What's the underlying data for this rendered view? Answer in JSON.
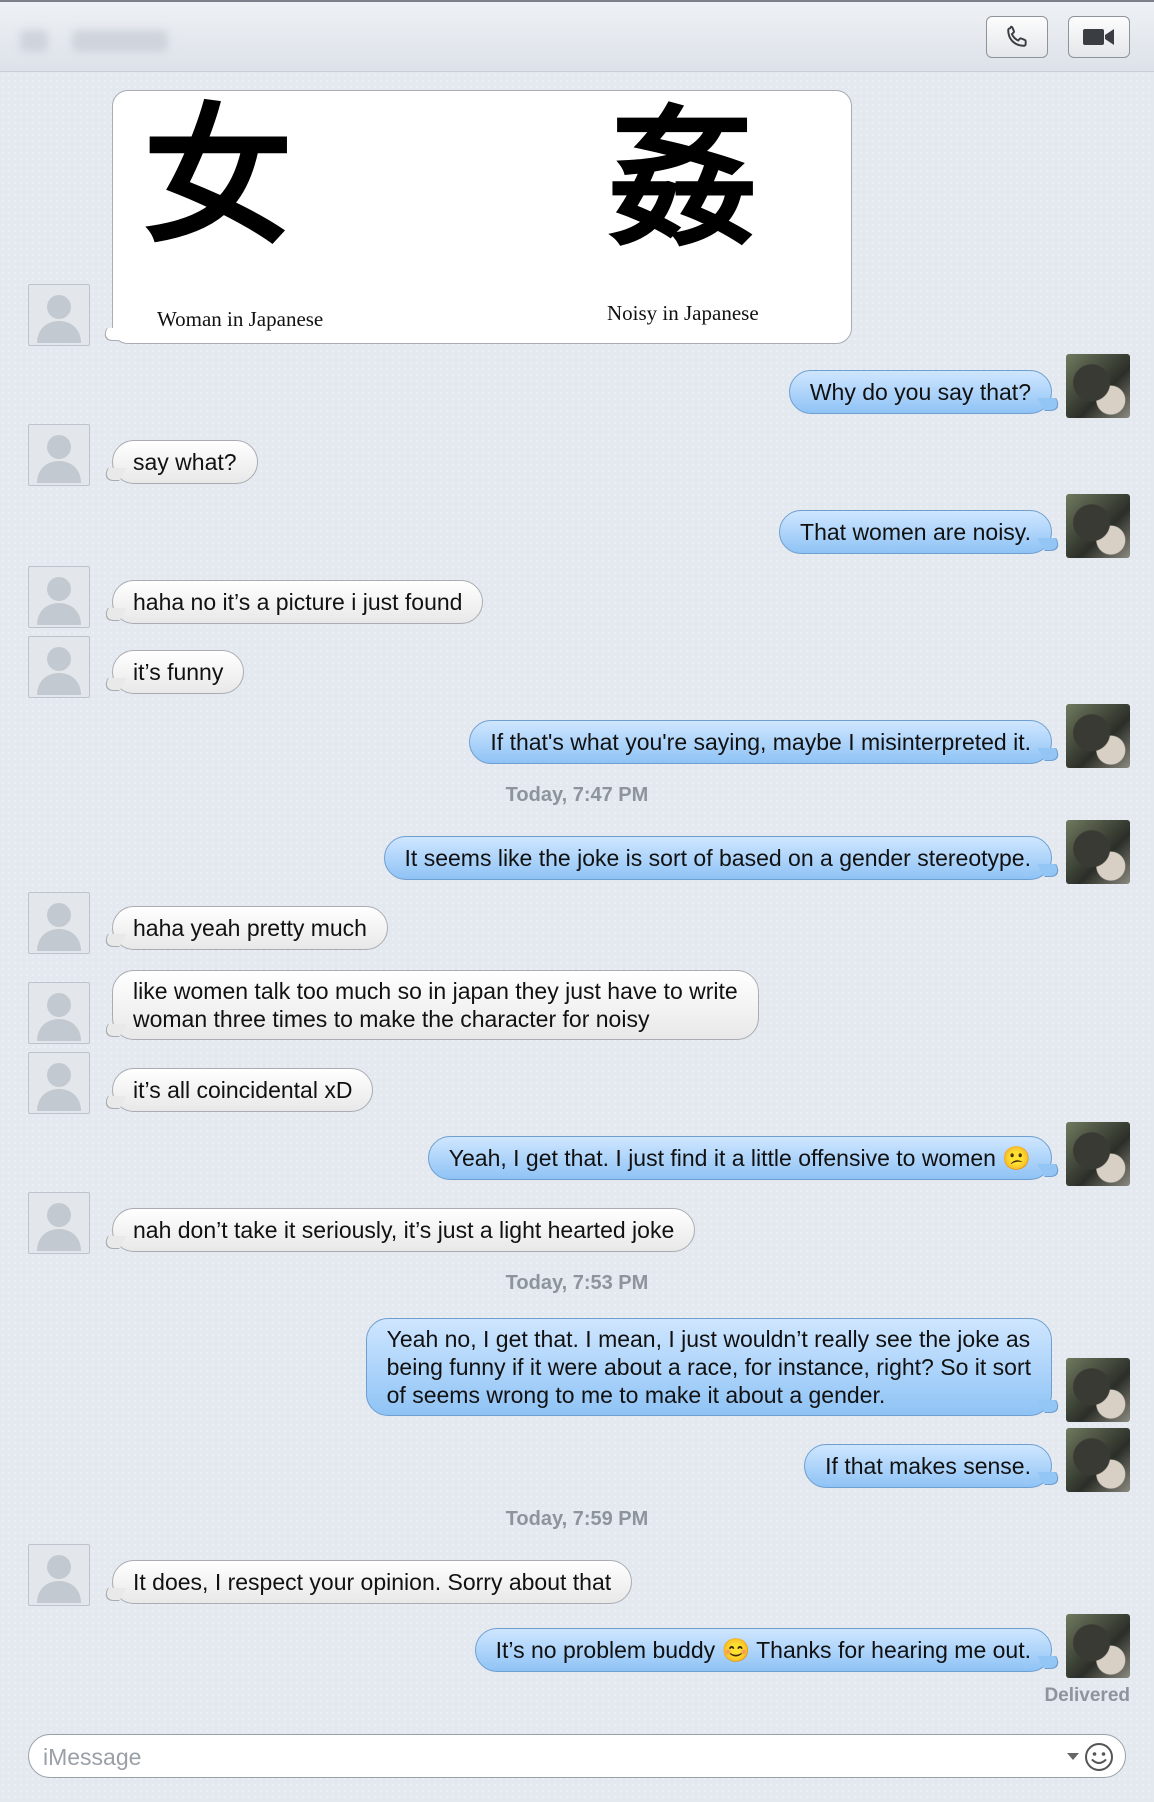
{
  "header": {
    "call_icon": "phone-icon",
    "video_icon": "video-camera-icon"
  },
  "image_message": {
    "left_character": "女",
    "left_caption": "Woman in Japanese",
    "right_character": "姦",
    "right_caption": "Noisy in Japanese"
  },
  "messages": [
    {
      "id": "m1",
      "from": "me",
      "text": "Why do you say that?"
    },
    {
      "id": "m2",
      "from": "other",
      "text": "say what?"
    },
    {
      "id": "m3",
      "from": "me",
      "text": "That women are noisy."
    },
    {
      "id": "m4",
      "from": "other",
      "text": "haha no it’s a picture i just found"
    },
    {
      "id": "m5",
      "from": "other",
      "text": "it’s funny"
    },
    {
      "id": "m6",
      "from": "me",
      "text": "If that's what you're saying, maybe I misinterpreted it."
    },
    {
      "id": "m7",
      "from": "me",
      "text": "It seems like the joke is sort of based on a gender stereotype."
    },
    {
      "id": "m8",
      "from": "other",
      "text": "haha yeah pretty much"
    },
    {
      "id": "m9",
      "from": "other",
      "lines": [
        "like women talk too much so in japan they just have to write",
        "woman three times to make the character for noisy"
      ]
    },
    {
      "id": "m10",
      "from": "other",
      "text": "it’s all coincidental xD"
    },
    {
      "id": "m11",
      "from": "me",
      "text": "Yeah, I get that. I just find it a little offensive to women 😕"
    },
    {
      "id": "m12",
      "from": "other",
      "text": "nah don’t take it seriously, it’s just a light hearted joke"
    },
    {
      "id": "m13",
      "from": "me",
      "lines": [
        "Yeah no, I get that. I mean, I just wouldn’t really see the joke as",
        "being funny if it were about a race, for instance, right? So it sort",
        "of seems wrong to me to make it about a gender."
      ]
    },
    {
      "id": "m14",
      "from": "me",
      "text": "If that makes sense."
    },
    {
      "id": "m15",
      "from": "other",
      "text": "It does, I respect your opinion. Sorry about that"
    },
    {
      "id": "m16",
      "from": "me",
      "text": "It’s no problem buddy 😊 Thanks for hearing me out."
    }
  ],
  "timestamps": [
    "Today, 7:47 PM",
    "Today, 7:53 PM",
    "Today, 7:59 PM"
  ],
  "status": "Delivered",
  "input": {
    "placeholder": "iMessage",
    "value": "",
    "emoji_icon": "emoji-smiley-icon"
  },
  "colors": {
    "outgoing_bubble": "#8fc3f5",
    "incoming_bubble": "#ffffff",
    "background": "#e4e8ef",
    "meta_text": "#8e949c"
  }
}
